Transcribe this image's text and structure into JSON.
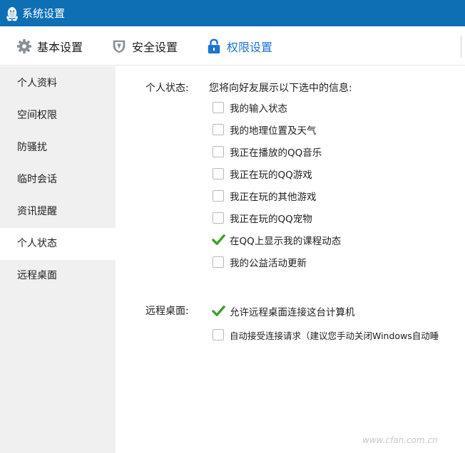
{
  "window": {
    "title": "系统设置",
    "logo_icon": "qq-penguin-icon"
  },
  "tabs": [
    {
      "label": "基本设置",
      "icon": "gear-icon",
      "active": false
    },
    {
      "label": "安全设置",
      "icon": "shield-icon",
      "active": false
    },
    {
      "label": "权限设置",
      "icon": "lock-icon",
      "active": true
    }
  ],
  "sidebar": {
    "items": [
      {
        "label": "个人资料",
        "active": false
      },
      {
        "label": "空间权限",
        "active": false
      },
      {
        "label": "防骚扰",
        "active": false
      },
      {
        "label": "临时会话",
        "active": false
      },
      {
        "label": "资讯提醒",
        "active": false
      },
      {
        "label": "个人状态",
        "active": true
      },
      {
        "label": "远程桌面",
        "active": false
      }
    ]
  },
  "personal_status": {
    "label": "个人状态:",
    "description": "您将向好友展示以下选中的信息:",
    "options": [
      {
        "label": "我的输入状态",
        "checked": false
      },
      {
        "label": "我的地理位置及天气",
        "checked": false
      },
      {
        "label": "我正在播放的QQ音乐",
        "checked": false
      },
      {
        "label": "我正在玩的QQ游戏",
        "checked": false
      },
      {
        "label": "我正在玩的其他游戏",
        "checked": false
      },
      {
        "label": "我正在玩的QQ宠物",
        "checked": false
      },
      {
        "label": "在QQ上显示我的课程动态",
        "checked": true
      },
      {
        "label": "我的公益活动更新",
        "checked": false
      }
    ]
  },
  "remote_desktop": {
    "label": "远程桌面:",
    "options": [
      {
        "label": "允许远程桌面连接这台计算机",
        "checked": true
      },
      {
        "label": "自动接受连接请求（建议您手动关闭Windows自动睡",
        "checked": false
      }
    ]
  },
  "colors": {
    "titlebar": "#0e6fb5",
    "active_tab_text": "#1b74d1",
    "check_green": "#3fa02a",
    "sidebar_bg": "#f0f0f0"
  },
  "watermark": "www.cfan.com.cn"
}
